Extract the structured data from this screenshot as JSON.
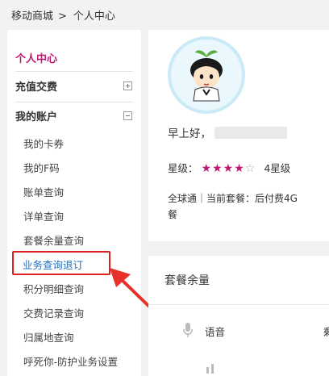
{
  "breadcrumb": {
    "home": "移动商城",
    "separator": ">",
    "current": "个人中心"
  },
  "sidebar": {
    "title": "个人中心",
    "recharge": {
      "label": "充值交费",
      "expanded": false
    },
    "account": {
      "label": "我的账户",
      "expanded": true
    },
    "items": [
      {
        "label": "我的卡券"
      },
      {
        "label": "我的F码"
      },
      {
        "label": "账单查询"
      },
      {
        "label": "详单查询"
      },
      {
        "label": "套餐余量查询"
      },
      {
        "label": "业务查询退订",
        "active": true
      },
      {
        "label": "积分明细查询"
      },
      {
        "label": "交费记录查询"
      },
      {
        "label": "归属地查询"
      },
      {
        "label": "呼死你-防护业务设置"
      }
    ]
  },
  "profile": {
    "greeting": "早上好，",
    "level_label": "星级：",
    "stars_filled": 4,
    "stars_total": 5,
    "level_text": "4星级",
    "plan_line1": "全球通｜当前套餐：后付费4G",
    "plan_line2": "餐"
  },
  "balance": {
    "title": "套餐余量",
    "voice_label": "语音",
    "voice_glyph": "剩"
  },
  "colors": {
    "accent": "#c01673",
    "link_blue": "#1f6fbf",
    "highlight_red": "#e02020"
  },
  "icons": {
    "recharge_toggle": "plus-box-icon",
    "account_toggle": "minus-box-icon",
    "voice": "microphone-icon"
  }
}
